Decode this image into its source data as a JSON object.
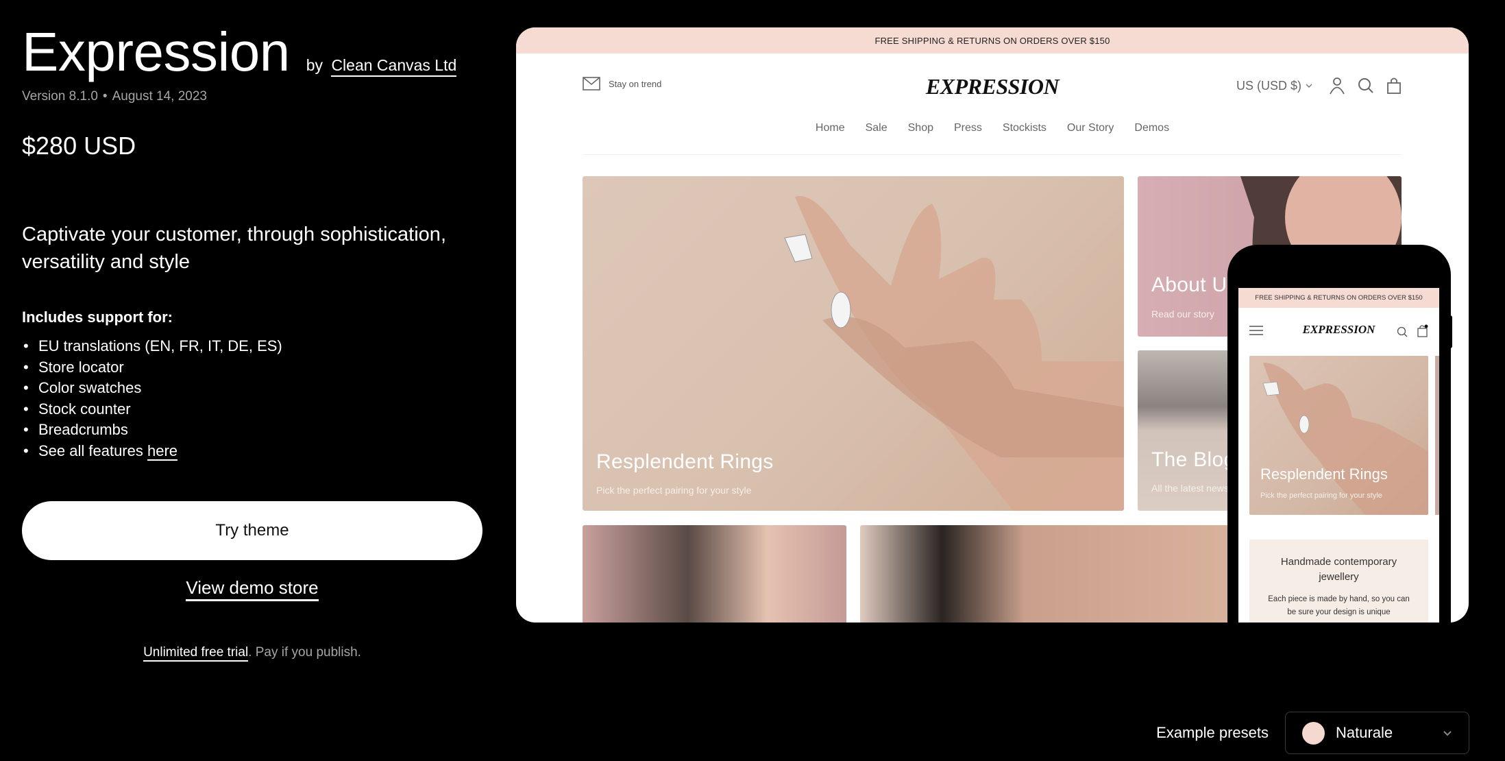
{
  "theme": {
    "title": "Expression",
    "by_prefix": "by",
    "author": "Clean Canvas Ltd",
    "version": "Version 8.1.0",
    "date": "August 14, 2023",
    "price": "$280 USD",
    "tagline": "Captivate your customer, through sophistication, versatility and style",
    "includes_heading": "Includes support for:",
    "features": [
      "EU translations (EN, FR, IT, DE, ES)",
      "Store locator",
      "Color swatches",
      "Stock counter",
      "Breadcrumbs"
    ],
    "see_all_prefix": "See all features",
    "see_all_link": "here",
    "try_button": "Try theme",
    "demo_link": "View demo store",
    "trial_link": "Unlimited free trial",
    "trial_suffix": ". Pay if you publish."
  },
  "desktop_preview": {
    "announcement": "FREE SHIPPING & RETURNS ON ORDERS OVER $150",
    "newsletter_text": "Stay on trend",
    "logo": "EXPRESSION",
    "currency": "US (USD $)",
    "nav": [
      "Home",
      "Sale",
      "Shop",
      "Press",
      "Stockists",
      "Our Story",
      "Demos"
    ],
    "tiles": {
      "rings": {
        "title": "Resplendent Rings",
        "subtitle": "Pick the perfect pairing for your style"
      },
      "about": {
        "title": "About Us",
        "subtitle": "Read our story"
      },
      "blog": {
        "title": "The Blog",
        "subtitle": "All the latest news"
      }
    }
  },
  "mobile_preview": {
    "announcement": "FREE SHIPPING & RETURNS ON ORDERS OVER $150",
    "logo": "EXPRESSION",
    "hero_title": "Resplendent Rings",
    "hero_subtitle": "Pick the perfect pairing for your style",
    "card_title": "Handmade contemporary jewellery",
    "card_text": "Each piece is made by hand, so you can be sure your design is unique"
  },
  "presets": {
    "label": "Example presets",
    "selected": "Naturale",
    "swatch_color": "#f5d8cf"
  },
  "colors": {
    "announcement_bg": "#f5dbd2",
    "page_bg": "#000000"
  }
}
